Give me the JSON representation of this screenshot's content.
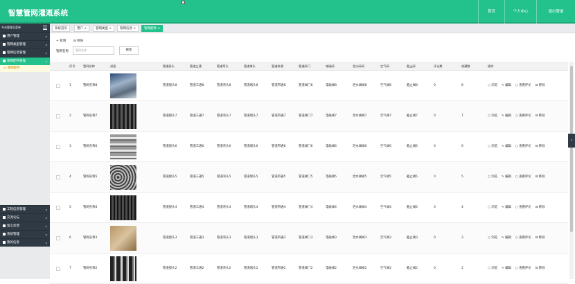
{
  "header": {
    "title": "智慧管网灌溉系统",
    "nav": [
      "首页",
      "个人中心",
      "退出登录"
    ]
  },
  "sidebar": {
    "head": "平台管理主菜单",
    "items": [
      {
        "label": "用户管理",
        "caret": "▸"
      },
      {
        "label": "管网类型管理",
        "caret": "▸"
      },
      {
        "label": "管网信息管理",
        "caret": "▸"
      },
      {
        "label": "管网配件管理",
        "caret": "▾"
      }
    ],
    "sub_item": "管网配件",
    "bottom_items": [
      {
        "label": "工程信息管理",
        "caret": "▸"
      },
      {
        "label": "交流论坛",
        "caret": "▸"
      },
      {
        "label": "留言反馈",
        "caret": "▸"
      },
      {
        "label": "系统管理",
        "caret": "▸"
      },
      {
        "label": "我的信息",
        "caret": "▸"
      }
    ]
  },
  "tabs": [
    "系统首页",
    "用户 ×",
    "管网类型 ×",
    "管网信息 ×",
    "管网配件 ×"
  ],
  "toolbar": {
    "add": "+ 新增",
    "remove": "⊟ 移除",
    "search_label": "管网名称",
    "search_placeholder": "管网名称",
    "search_button": "搜索"
  },
  "table": {
    "headers": [
      "序号",
      "管网名称",
      "封面",
      "管道接头",
      "管道三通",
      "管道弯头",
      "管道堵头",
      "管道带通",
      "管道阀门",
      "电磁阀",
      "泄水阀阀",
      "空气阀",
      "截止阀",
      "评论数",
      "收藏数",
      "操作"
    ],
    "rows": [
      {
        "no": "1",
        "name": "管网名称8",
        "c1": "管道接头8",
        "c2": "管道三通8",
        "c3": "管道弯头8",
        "c4": "管道堵头8",
        "c5": "管道带通8",
        "c6": "管道阀门8",
        "c7": "电磁阀8",
        "c8": "泄水阀阀8",
        "c9": "空气阀8",
        "c10": "截止阀8",
        "comments": "0",
        "favs": "8"
      },
      {
        "no": "2",
        "name": "管网名称7",
        "c1": "管道接头7",
        "c2": "管道三通7",
        "c3": "管道弯头7",
        "c4": "管道堵头7",
        "c5": "管道带通7",
        "c6": "管道阀门7",
        "c7": "电磁阀7",
        "c8": "泄水阀阀7",
        "c9": "空气阀7",
        "c10": "截止阀7",
        "comments": "0",
        "favs": "7"
      },
      {
        "no": "3",
        "name": "管网名称6",
        "c1": "管道接头6",
        "c2": "管道三通6",
        "c3": "管道弯头6",
        "c4": "管道堵头6",
        "c5": "管道带通6",
        "c6": "管道阀门6",
        "c7": "电磁阀6",
        "c8": "泄水阀阀6",
        "c9": "空气阀6",
        "c10": "截止阀6",
        "comments": "0",
        "favs": "6"
      },
      {
        "no": "4",
        "name": "管网名称5",
        "c1": "管道接头5",
        "c2": "管道三通5",
        "c3": "管道弯头5",
        "c4": "管道堵头5",
        "c5": "管道带通5",
        "c6": "管道阀门5",
        "c7": "电磁阀5",
        "c8": "泄水阀阀5",
        "c9": "空气阀5",
        "c10": "截止阀5",
        "comments": "0",
        "favs": "5"
      },
      {
        "no": "5",
        "name": "管网名称4",
        "c1": "管道接头4",
        "c2": "管道三通4",
        "c3": "管道弯头4",
        "c4": "管道堵头4",
        "c5": "管道带通4",
        "c6": "管道阀门4",
        "c7": "电磁阀4",
        "c8": "泄水阀阀4",
        "c9": "空气阀4",
        "c10": "截止阀4",
        "comments": "0",
        "favs": "4"
      },
      {
        "no": "6",
        "name": "管网名称3",
        "c1": "管道接头3",
        "c2": "管道三通3",
        "c3": "管道弯头3",
        "c4": "管道堵头3",
        "c5": "管道带通3",
        "c6": "管道阀门3",
        "c7": "电磁阀3",
        "c8": "泄水阀阀3",
        "c9": "空气阀3",
        "c10": "截止阀3",
        "comments": "0",
        "favs": "3"
      },
      {
        "no": "7",
        "name": "管网名称2",
        "c1": "管道接头2",
        "c2": "管道三通2",
        "c3": "管道弯头2",
        "c4": "管道堵头2",
        "c5": "管道带通2",
        "c6": "管道阀门2",
        "c7": "电磁阀2",
        "c8": "泄水阀阀2",
        "c9": "空气阀2",
        "c10": "截止阀2",
        "comments": "0",
        "favs": "2"
      }
    ],
    "actions": [
      "○ 浏览",
      "✎ 编辑",
      "○ 查看评论",
      "⊟ 移除"
    ]
  },
  "colors": {
    "brand": "#23c28c",
    "sidebar": "#2f3a45"
  }
}
